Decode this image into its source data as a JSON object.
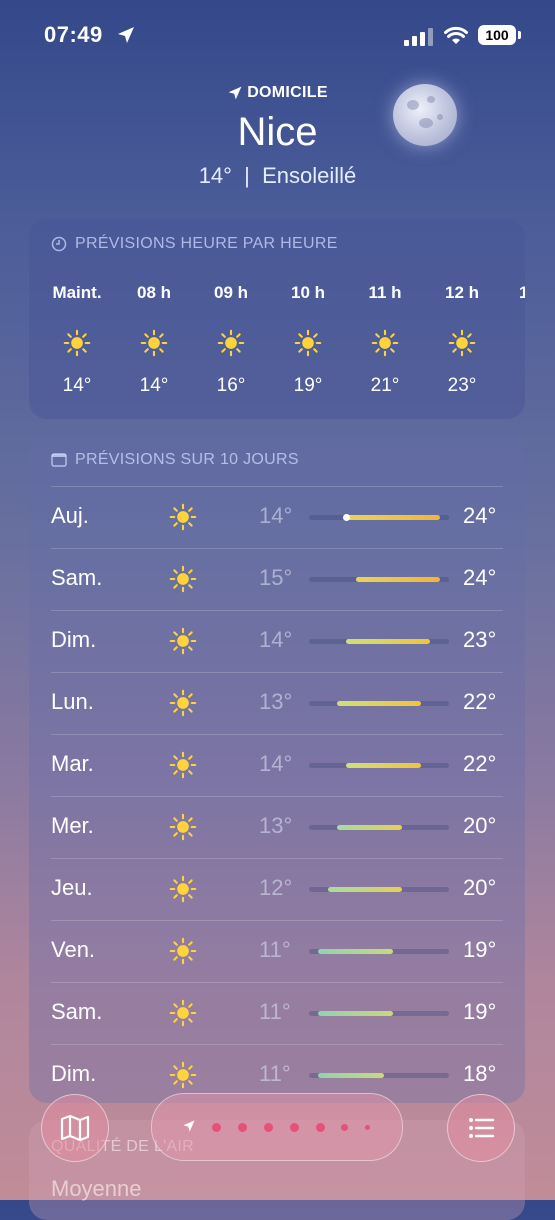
{
  "status_bar": {
    "time": "07:49",
    "battery": "100"
  },
  "header": {
    "home_label": "DOMICILE",
    "city": "Nice",
    "summary": "14°  |  Ensoleillé"
  },
  "hourly": {
    "title": "PRÉVISIONS HEURE PAR HEURE",
    "hours": [
      {
        "label": "Maint.",
        "temp": "14°",
        "icon": "sun-icon"
      },
      {
        "label": "08 h",
        "temp": "14°",
        "icon": "sun-icon"
      },
      {
        "label": "09 h",
        "temp": "16°",
        "icon": "sun-icon"
      },
      {
        "label": "10 h",
        "temp": "19°",
        "icon": "sun-icon"
      },
      {
        "label": "11 h",
        "temp": "21°",
        "icon": "sun-icon"
      },
      {
        "label": "12 h",
        "temp": "23°",
        "icon": "sun-icon"
      }
    ]
  },
  "daily": {
    "title": "PRÉVISIONS SUR 10 JOURS",
    "days": [
      {
        "day": "Auj.",
        "low": "14°",
        "high": "24°",
        "low_value": 14,
        "high_value": 24,
        "current": 14
      },
      {
        "day": "Sam.",
        "low": "15°",
        "high": "24°",
        "low_value": 15,
        "high_value": 24
      },
      {
        "day": "Dim.",
        "low": "14°",
        "high": "23°",
        "low_value": 14,
        "high_value": 23
      },
      {
        "day": "Lun.",
        "low": "13°",
        "high": "22°",
        "low_value": 13,
        "high_value": 22
      },
      {
        "day": "Mar.",
        "low": "14°",
        "high": "22°",
        "low_value": 14,
        "high_value": 22
      },
      {
        "day": "Mer.",
        "low": "13°",
        "high": "20°",
        "low_value": 13,
        "high_value": 20
      },
      {
        "day": "Jeu.",
        "low": "12°",
        "high": "20°",
        "low_value": 12,
        "high_value": 20
      },
      {
        "day": "Ven.",
        "low": "11°",
        "high": "19°",
        "low_value": 11,
        "high_value": 19
      },
      {
        "day": "Sam.",
        "low": "11°",
        "high": "19°",
        "low_value": 11,
        "high_value": 19
      },
      {
        "day": "Dim.",
        "low": "11°",
        "high": "18°",
        "low_value": 11,
        "high_value": 18
      }
    ]
  },
  "air_quality": {
    "title": "QUALITÉ DE L'AIR",
    "value": "Moyenne"
  },
  "colors": {
    "warm": "#f2c23a",
    "mild": "#e8d45a",
    "cool": "#8fd3b0",
    "sun": "#ffd43b"
  }
}
